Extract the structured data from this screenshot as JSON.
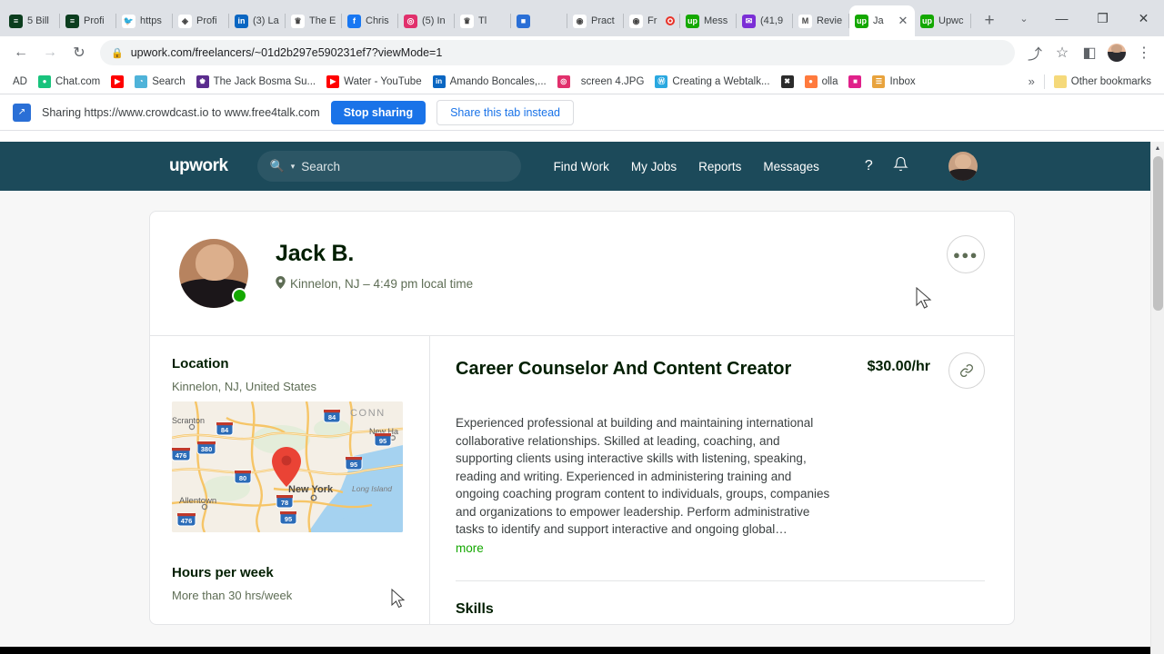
{
  "browser": {
    "tabs": [
      {
        "label": "5 Bill",
        "favicon": "matrix-icon",
        "color": "#0b3d1e",
        "glyph": "≡",
        "active": false,
        "recording": false
      },
      {
        "label": "Profi",
        "favicon": "matrix-icon",
        "color": "#0b3d1e",
        "glyph": "≡",
        "active": false,
        "recording": false
      },
      {
        "label": "https",
        "favicon": "twitter-icon",
        "color": "#ffffff",
        "glyph": "🐦",
        "active": false,
        "recording": false
      },
      {
        "label": "Profi",
        "favicon": "diamond-icon",
        "color": "#ffffff",
        "glyph": "◈",
        "active": false,
        "recording": false
      },
      {
        "label": "(3) La",
        "favicon": "linkedin-icon",
        "color": "#0a66c2",
        "glyph": "in",
        "active": false,
        "recording": false
      },
      {
        "label": "The E",
        "favicon": "anchor-icon",
        "color": "#ffffff",
        "glyph": "♛",
        "active": false,
        "recording": false
      },
      {
        "label": "Chris",
        "favicon": "facebook-icon",
        "color": "#1877f2",
        "glyph": "f",
        "active": false,
        "recording": false
      },
      {
        "label": "(5) In",
        "favicon": "instagram-icon",
        "color": "#e1306c",
        "glyph": "◎",
        "active": false,
        "recording": false
      },
      {
        "label": "Tl",
        "favicon": "anchor-icon",
        "color": "#ffffff",
        "glyph": "♛",
        "active": false,
        "recording": false
      },
      {
        "label": "",
        "favicon": "screen-icon",
        "color": "#2a6fd6",
        "glyph": "■",
        "active": false,
        "recording": false
      },
      {
        "label": "Pract",
        "favicon": "circle-blue-icon",
        "color": "#ffffff",
        "glyph": "◉",
        "active": false,
        "recording": false
      },
      {
        "label": "Fr",
        "favicon": "circle-blue-icon",
        "color": "#ffffff",
        "glyph": "◉",
        "active": false,
        "recording": true
      },
      {
        "label": "Mess",
        "favicon": "upwork-icon",
        "color": "#14a800",
        "glyph": "up",
        "active": false,
        "recording": false
      },
      {
        "label": "(41,9",
        "favicon": "mail-icon",
        "color": "#7b2fd6",
        "glyph": "✉",
        "active": false,
        "recording": false
      },
      {
        "label": "Revie",
        "favicon": "gmail-icon",
        "color": "#ffffff",
        "glyph": "M",
        "active": false,
        "recording": false
      },
      {
        "label": "Ja",
        "favicon": "upwork-icon",
        "color": "#14a800",
        "glyph": "up",
        "active": true,
        "recording": false
      },
      {
        "label": "Upwc",
        "favicon": "upwork-icon",
        "color": "#14a800",
        "glyph": "up",
        "active": false,
        "recording": false
      }
    ],
    "new_tab_label": "+",
    "tab_search_label": "⌄",
    "window_minimize": "—",
    "window_maximize": "❐",
    "window_close": "✕",
    "back_label": "←",
    "forward_label": "→",
    "reload_label": "↻",
    "url": "upwork.com/freelancers/~01d2b297e590231ef7?viewMode=1",
    "lock_icon": "🔒",
    "share_toolbar_icon": "⤴",
    "bookmark_star_icon": "☆",
    "sidepanel_icon": "◧",
    "menu_icon": "⋮",
    "bookmarks": [
      {
        "label": "AD",
        "icon": "text-icon",
        "color": "transparent",
        "glyph": ""
      },
      {
        "label": "Chat.com",
        "icon": "chat-icon",
        "color": "#19c37d",
        "glyph": "●"
      },
      {
        "label": "",
        "icon": "youtube-icon",
        "color": "#ff0000",
        "glyph": "▶"
      },
      {
        "label": "Search",
        "icon": "search-bm-icon",
        "color": "#4fb3d9",
        "glyph": "◔"
      },
      {
        "label": "The Jack Bosma Su...",
        "icon": "crown-icon",
        "color": "#5b2d8e",
        "glyph": "♚"
      },
      {
        "label": "Water - YouTube",
        "icon": "youtube-icon",
        "color": "#ff0000",
        "glyph": "▶"
      },
      {
        "label": "Amando Boncales,...",
        "icon": "linkedin-icon",
        "color": "#0a66c2",
        "glyph": "in"
      },
      {
        "label": "",
        "icon": "instagram-icon",
        "color": "#e1306c",
        "glyph": "◎"
      },
      {
        "label": "screen 4.JPG",
        "icon": "file-icon",
        "color": "transparent",
        "glyph": ""
      },
      {
        "label": "Creating a Webtalk...",
        "icon": "webtalk-icon",
        "color": "#2aa8e0",
        "glyph": "Ⓦ"
      },
      {
        "label": "",
        "icon": "bowtie-icon",
        "color": "#2b2b2b",
        "glyph": "✖"
      },
      {
        "label": "olla",
        "icon": "olla-icon",
        "color": "#ff7a3d",
        "glyph": "●"
      },
      {
        "label": "",
        "icon": "pink-app-icon",
        "color": "#e0218a",
        "glyph": "■"
      },
      {
        "label": "Inbox",
        "icon": "inbox-icon",
        "color": "#e8a33d",
        "glyph": "☰"
      }
    ],
    "bookmarks_overflow": "»",
    "other_bookmarks_label": "Other bookmarks",
    "other_bookmarks_icon": "folder-icon"
  },
  "sharing_bar": {
    "icon": "screen-share-icon",
    "message": "Sharing https://www.crowdcast.io to www.free4talk.com",
    "stop_label": "Stop sharing",
    "instead_label": "Share this tab instead",
    "primary_color": "#1a73e8"
  },
  "upwork_nav": {
    "logo": "upwork",
    "search_placeholder": "Search",
    "search_icon": "search-icon",
    "search_chevron": "⌄",
    "links": [
      "Find Work",
      "My Jobs",
      "Reports",
      "Messages"
    ],
    "help_icon": "?",
    "bell_icon": "🔔",
    "nav_bg": "#1c4a5a"
  },
  "profile": {
    "name": "Jack B.",
    "location_line": "Kinnelon, NJ – 4:49 pm local time",
    "location_pin_icon": "map-pin-icon",
    "more_menu_label": "●●●",
    "online_status_color": "#14a800"
  },
  "sidebar": {
    "location_title": "Location",
    "location_value": "Kinnelon, NJ, United States",
    "hours_title": "Hours per week",
    "hours_value": "More than 30 hrs/week",
    "map": {
      "cities": [
        "Scranton",
        "Allentown",
        "New York",
        "New Ha",
        "Long Island"
      ],
      "region_label": "CONN",
      "highways": [
        "84",
        "380",
        "476",
        "80",
        "78",
        "95",
        "95",
        "95",
        "476"
      ],
      "marker_color": "#ea4335"
    }
  },
  "main": {
    "job_title": "Career Counselor And Content Creator",
    "rate": "$30.00/hr",
    "link_icon": "link-icon",
    "description": "Experienced professional at building and maintaining international collaborative relationships. Skilled at leading, coaching, and supporting clients using interactive skills with listening, speaking, reading and writing. Experienced in administering training and ongoing coaching program content to individuals, groups, companies and organizations to empower leadership. Perform administrative tasks to identify and support interactive and ongoing global…",
    "more_label": "more",
    "more_color": "#14a800",
    "skills_title": "Skills"
  },
  "scrollbar": {
    "up_arrow": "▲"
  }
}
